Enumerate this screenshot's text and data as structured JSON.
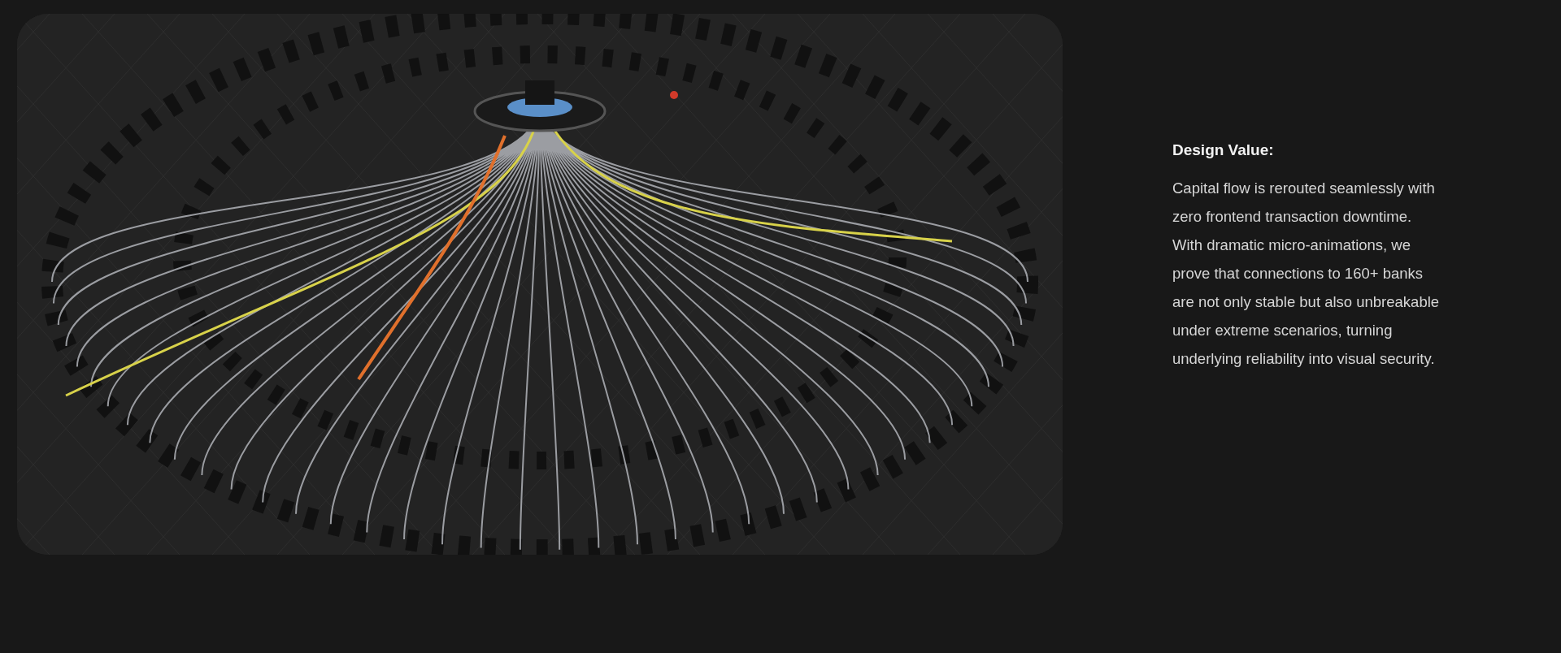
{
  "showcase": {
    "heading": "Design Value:",
    "body": "Capital flow is rerouted seamlessly with zero frontend transaction downtime. With dramatic micro-animations, we prove that connections to 160+ banks are not only stable but also unbreakable under extreme scenarios, turning underlying reliability into visual security."
  }
}
